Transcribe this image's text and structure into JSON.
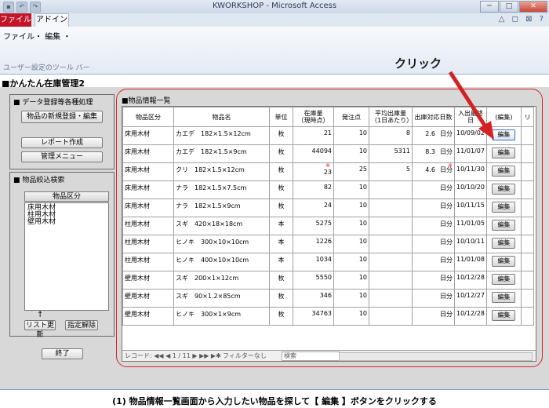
{
  "window": {
    "title": "KWORKSHOP - Microsoft Access",
    "controls": [
      "─",
      "□",
      "✕"
    ]
  },
  "ribbon": {
    "tab_file": "ファイル",
    "tab_addin": "アドイン",
    "menu": "ファイル・ 編集 ・",
    "toolbar_label": "ユーザー設定のツール バー",
    "right_icons": "△ ◻ ⊠ ?"
  },
  "form": {
    "title": "■かんたん在庫管理2",
    "section1_title": "■ データ登録等各種処理",
    "btn_new": "物品の新規登録・編集",
    "btn_report": "レポート作成",
    "btn_admin": "管理メニュー",
    "section2_title": "■ 物品絞込検索",
    "category_header": "物品区分",
    "categories": [
      "床用木材",
      "柱用木材",
      "壁用木材"
    ],
    "btn_refresh": "リスト更新",
    "btn_clear": "指定解除",
    "btn_exit": "終了",
    "arrow": "↑"
  },
  "subform": {
    "title": "■物品情報一覧",
    "columns": [
      "物品区分",
      "物品名",
      "単位",
      "在庫量\n（現時点）",
      "発注点",
      "平均出庫量\n（1日あたり）",
      "出庫対応日数",
      "入出最終日",
      "(編集)",
      "リ"
    ],
    "rows": [
      {
        "cat": "床用木材",
        "name": "カエデ　182×1.5×12cm",
        "unit": "枚",
        "stock": "21",
        "order": "10",
        "avg": "8",
        "days": "2.6",
        "dunit": "日分",
        "date": "10/09/02",
        "mark": false
      },
      {
        "cat": "床用木材",
        "name": "カエデ　182×1.5×9cm",
        "unit": "枚",
        "stock": "44094",
        "order": "10",
        "avg": "5311",
        "days": "8.3",
        "dunit": "日分",
        "date": "11/01/07",
        "mark": false
      },
      {
        "cat": "床用木材",
        "name": "クリ　182×1.5×12cm",
        "unit": "枚",
        "stock": "23",
        "order": "25",
        "avg": "5",
        "days": "4.6",
        "dunit": "日分",
        "date": "10/11/30",
        "mark": true
      },
      {
        "cat": "床用木材",
        "name": "ナラ　182×1.5×7.5cm",
        "unit": "枚",
        "stock": "82",
        "order": "10",
        "avg": "",
        "days": "",
        "dunit": "日分",
        "date": "10/10/20",
        "mark": false
      },
      {
        "cat": "床用木材",
        "name": "ナラ　182×1.5×9cm",
        "unit": "枚",
        "stock": "24",
        "order": "10",
        "avg": "",
        "days": "",
        "dunit": "日分",
        "date": "10/11/15",
        "mark": false
      },
      {
        "cat": "柱用木材",
        "name": "スギ　420×18×18cm",
        "unit": "本",
        "stock": "5275",
        "order": "10",
        "avg": "",
        "days": "",
        "dunit": "日分",
        "date": "11/01/05",
        "mark": false
      },
      {
        "cat": "柱用木材",
        "name": "ヒノキ　300×10×10cm",
        "unit": "本",
        "stock": "1226",
        "order": "10",
        "avg": "",
        "days": "",
        "dunit": "日分",
        "date": "10/10/11",
        "mark": false
      },
      {
        "cat": "柱用木材",
        "name": "ヒノキ　400×10×10cm",
        "unit": "本",
        "stock": "1034",
        "order": "10",
        "avg": "",
        "days": "",
        "dunit": "日分",
        "date": "11/01/08",
        "mark": false
      },
      {
        "cat": "壁用木材",
        "name": "スギ　200×1×12cm",
        "unit": "枚",
        "stock": "5550",
        "order": "10",
        "avg": "",
        "days": "",
        "dunit": "日分",
        "date": "10/12/28",
        "mark": false
      },
      {
        "cat": "壁用木材",
        "name": "スギ　90×1.2×85cm",
        "unit": "枚",
        "stock": "346",
        "order": "10",
        "avg": "",
        "days": "",
        "dunit": "日分",
        "date": "10/12/27",
        "mark": false
      },
      {
        "cat": "壁用木材",
        "name": "ヒノキ　300×1×9cm",
        "unit": "枚",
        "stock": "34763",
        "order": "10",
        "avg": "",
        "days": "",
        "dunit": "日分",
        "date": "10/12/28",
        "mark": false
      }
    ],
    "edit_label": "編集",
    "mark_symbol": "※",
    "nav_record": "レコード: ◀◀ ◀ 1 / 11 ▶ ▶▶ ▶✱",
    "nav_filter": "フィルターなし",
    "nav_search": "検索"
  },
  "annotation": {
    "callout": "クリック",
    "caption": "(1) 物品情報一覧画面から入力したい物品を探して【 編集 】ボタンをクリックする",
    "color": "#d22222"
  }
}
